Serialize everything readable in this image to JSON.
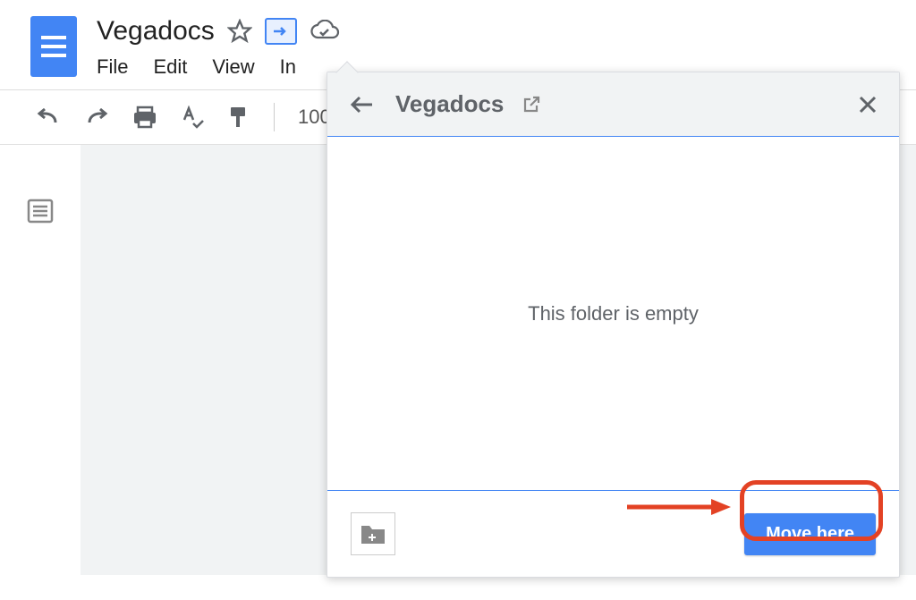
{
  "document": {
    "title": "Vegadocs"
  },
  "menu": {
    "file": "File",
    "edit": "Edit",
    "view": "View",
    "insert_partial": "In"
  },
  "toolbar": {
    "zoom": "100"
  },
  "popover": {
    "title": "Vegadocs",
    "empty_message": "This folder is empty",
    "move_button": "Move here"
  }
}
